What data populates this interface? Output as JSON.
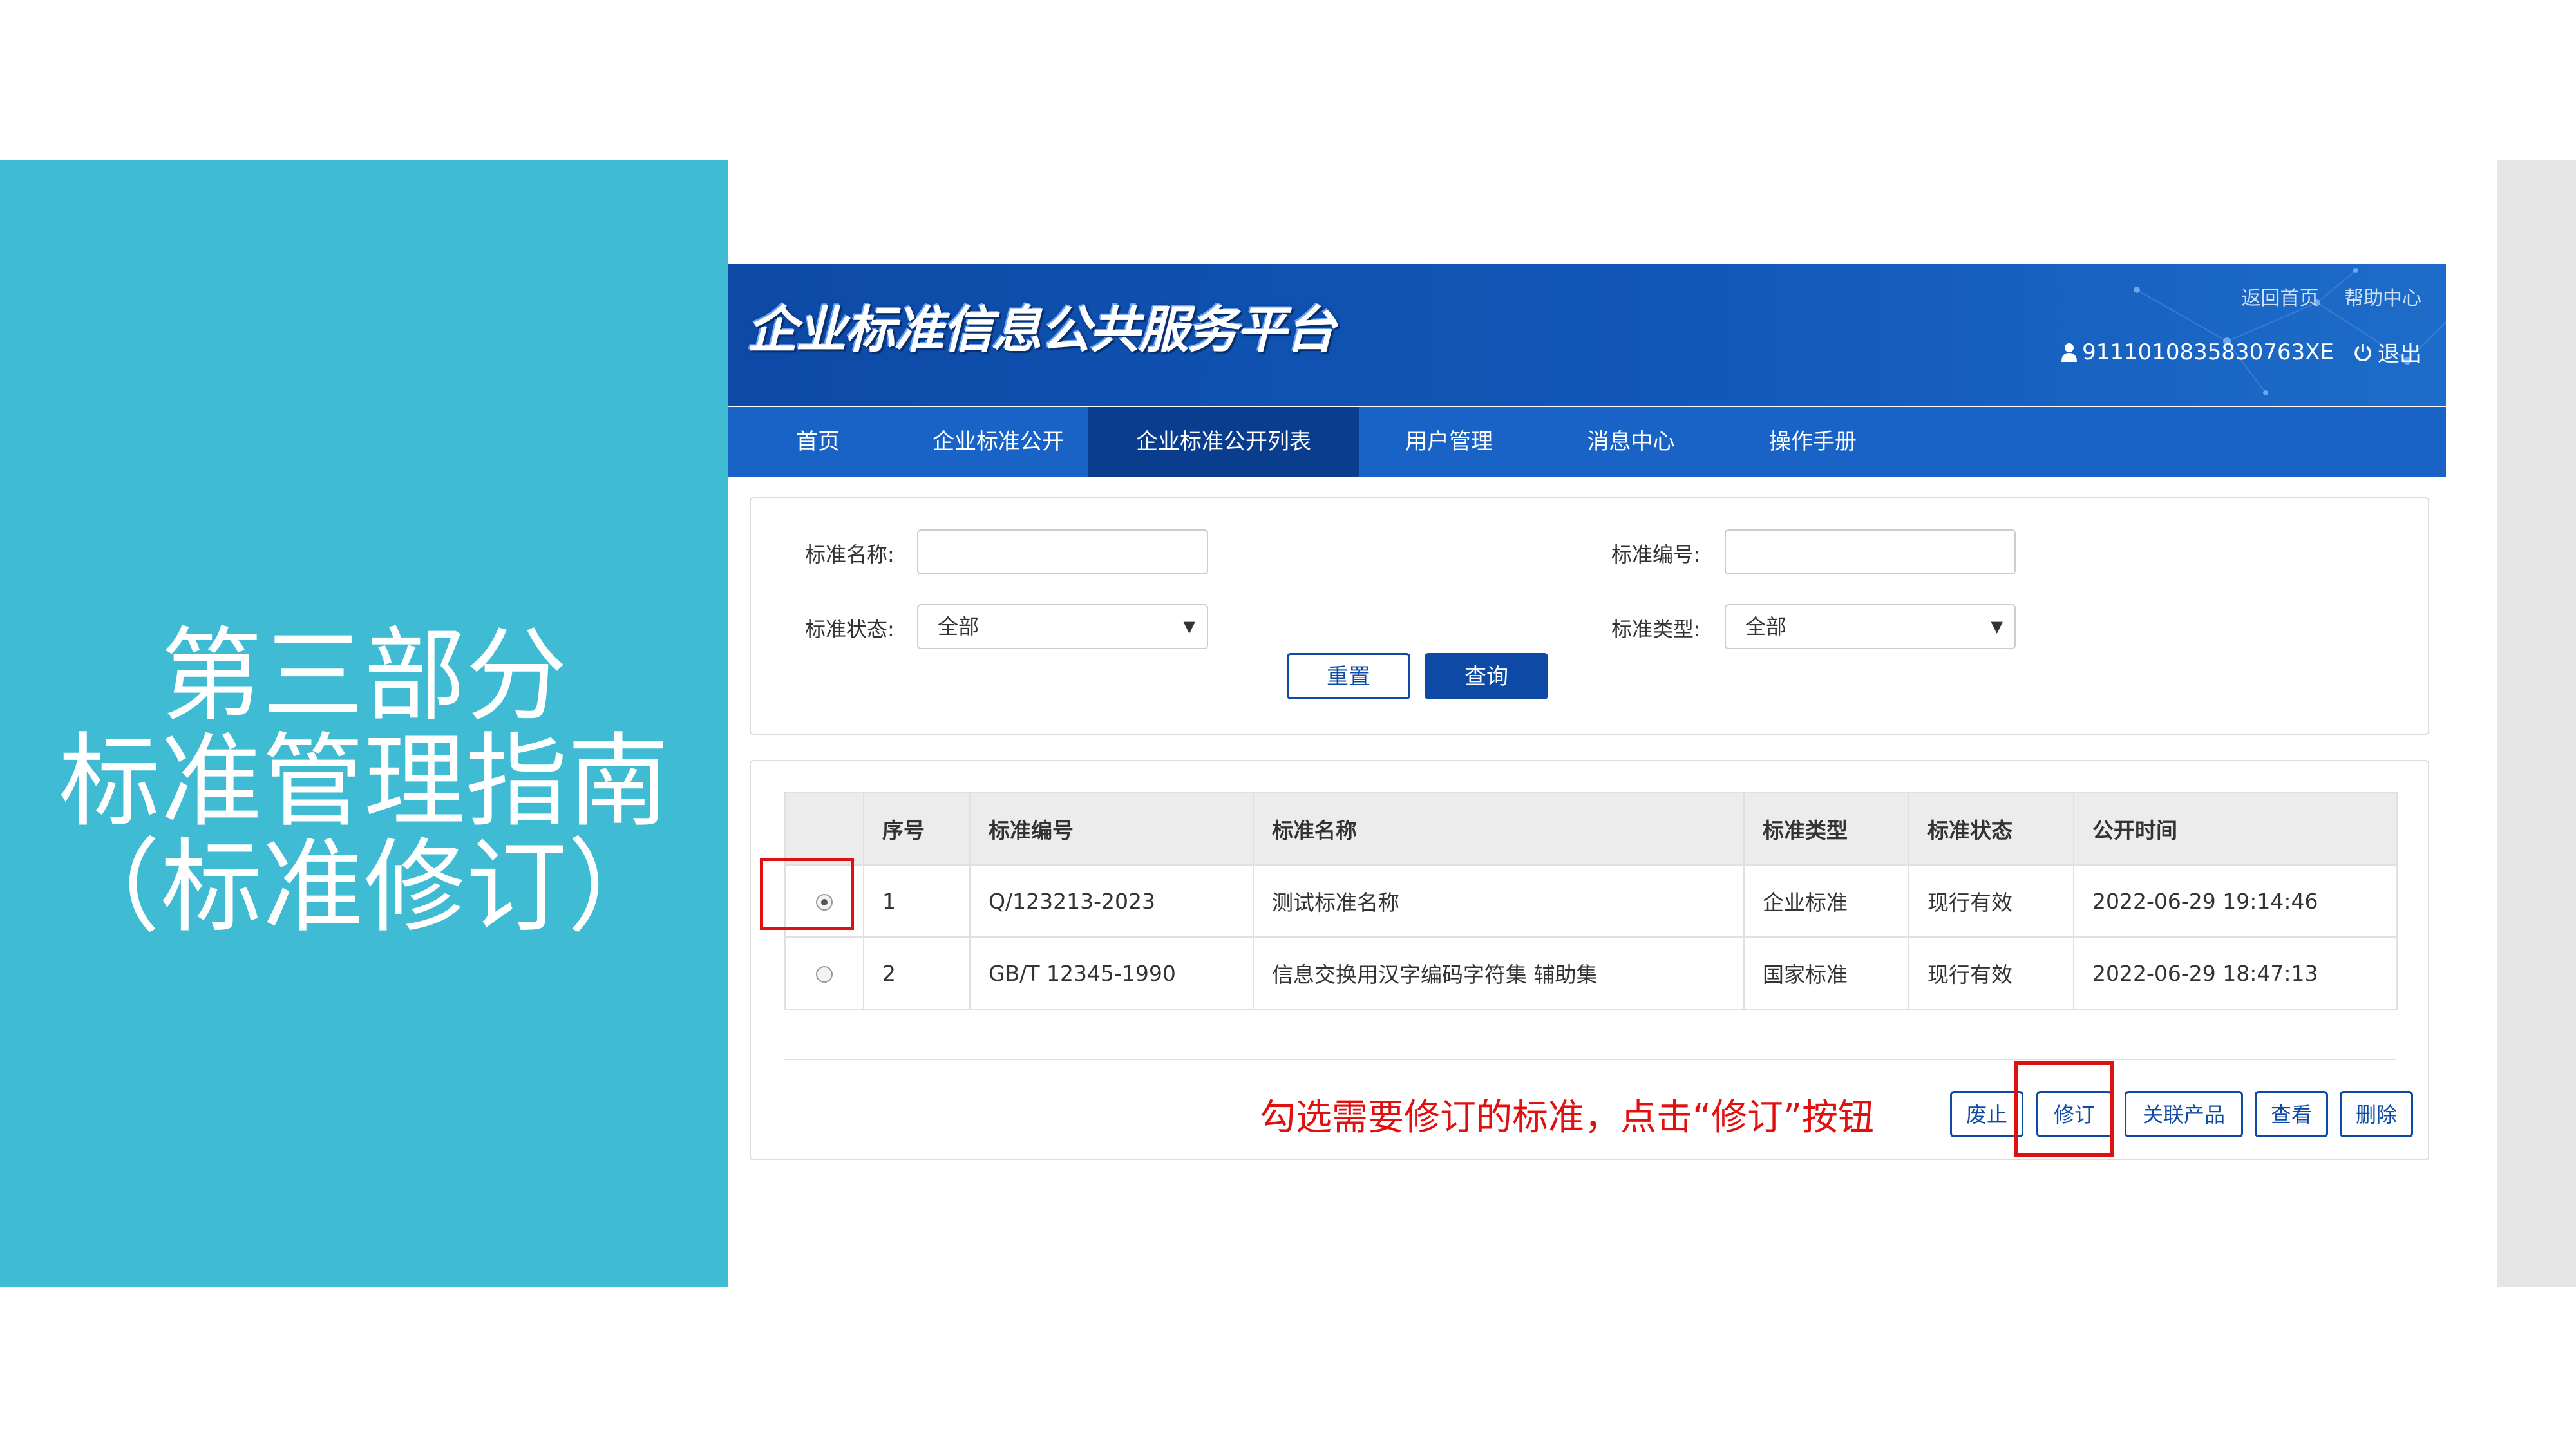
{
  "slide": {
    "title_lines": [
      "第三部分",
      "标准管理指南",
      "（标准修订）"
    ]
  },
  "header": {
    "logo_text": "企业标准信息公共服务平台",
    "links": [
      "返回首页",
      "帮助中心"
    ],
    "user_id": "9111010835830763XE",
    "logout_label": "退出"
  },
  "nav": {
    "items": [
      "首页",
      "企业标准公开",
      "企业标准公开列表",
      "用户管理",
      "消息中心",
      "操作手册"
    ],
    "active_index": 2
  },
  "search": {
    "name_label": "标准名称:",
    "name_value": "",
    "code_label": "标准编号:",
    "code_value": "",
    "status_label": "标准状态:",
    "status_value": "全部",
    "type_label": "标准类型:",
    "type_value": "全部",
    "reset_label": "重置",
    "query_label": "查询"
  },
  "table": {
    "headers": [
      "",
      "序号",
      "标准编号",
      "标准名称",
      "标准类型",
      "标准状态",
      "公开时间"
    ],
    "rows": [
      {
        "selected": true,
        "seq": "1",
        "code": "Q/123213-2023",
        "name": "测试标准名称",
        "type": "企业标准",
        "status": "现行有效",
        "time": "2022-06-29 19:14:46"
      },
      {
        "selected": false,
        "seq": "2",
        "code": "GB/T 12345-1990",
        "name": "信息交换用汉字编码字符集 辅助集",
        "type": "国家标准",
        "status": "现行有效",
        "time": "2022-06-29 18:47:13"
      }
    ]
  },
  "actions": {
    "hint": "勾选需要修订的标准，点击“修订”按钮",
    "buttons": [
      "废止",
      "修订",
      "关联产品",
      "查看",
      "删除"
    ]
  },
  "colors": {
    "slide_panel": "#3fbbd3",
    "header_blue": "#0d4aa6",
    "nav_blue": "#1a63c6",
    "nav_active": "#0b3d8e",
    "highlight_red": "#e01010"
  }
}
